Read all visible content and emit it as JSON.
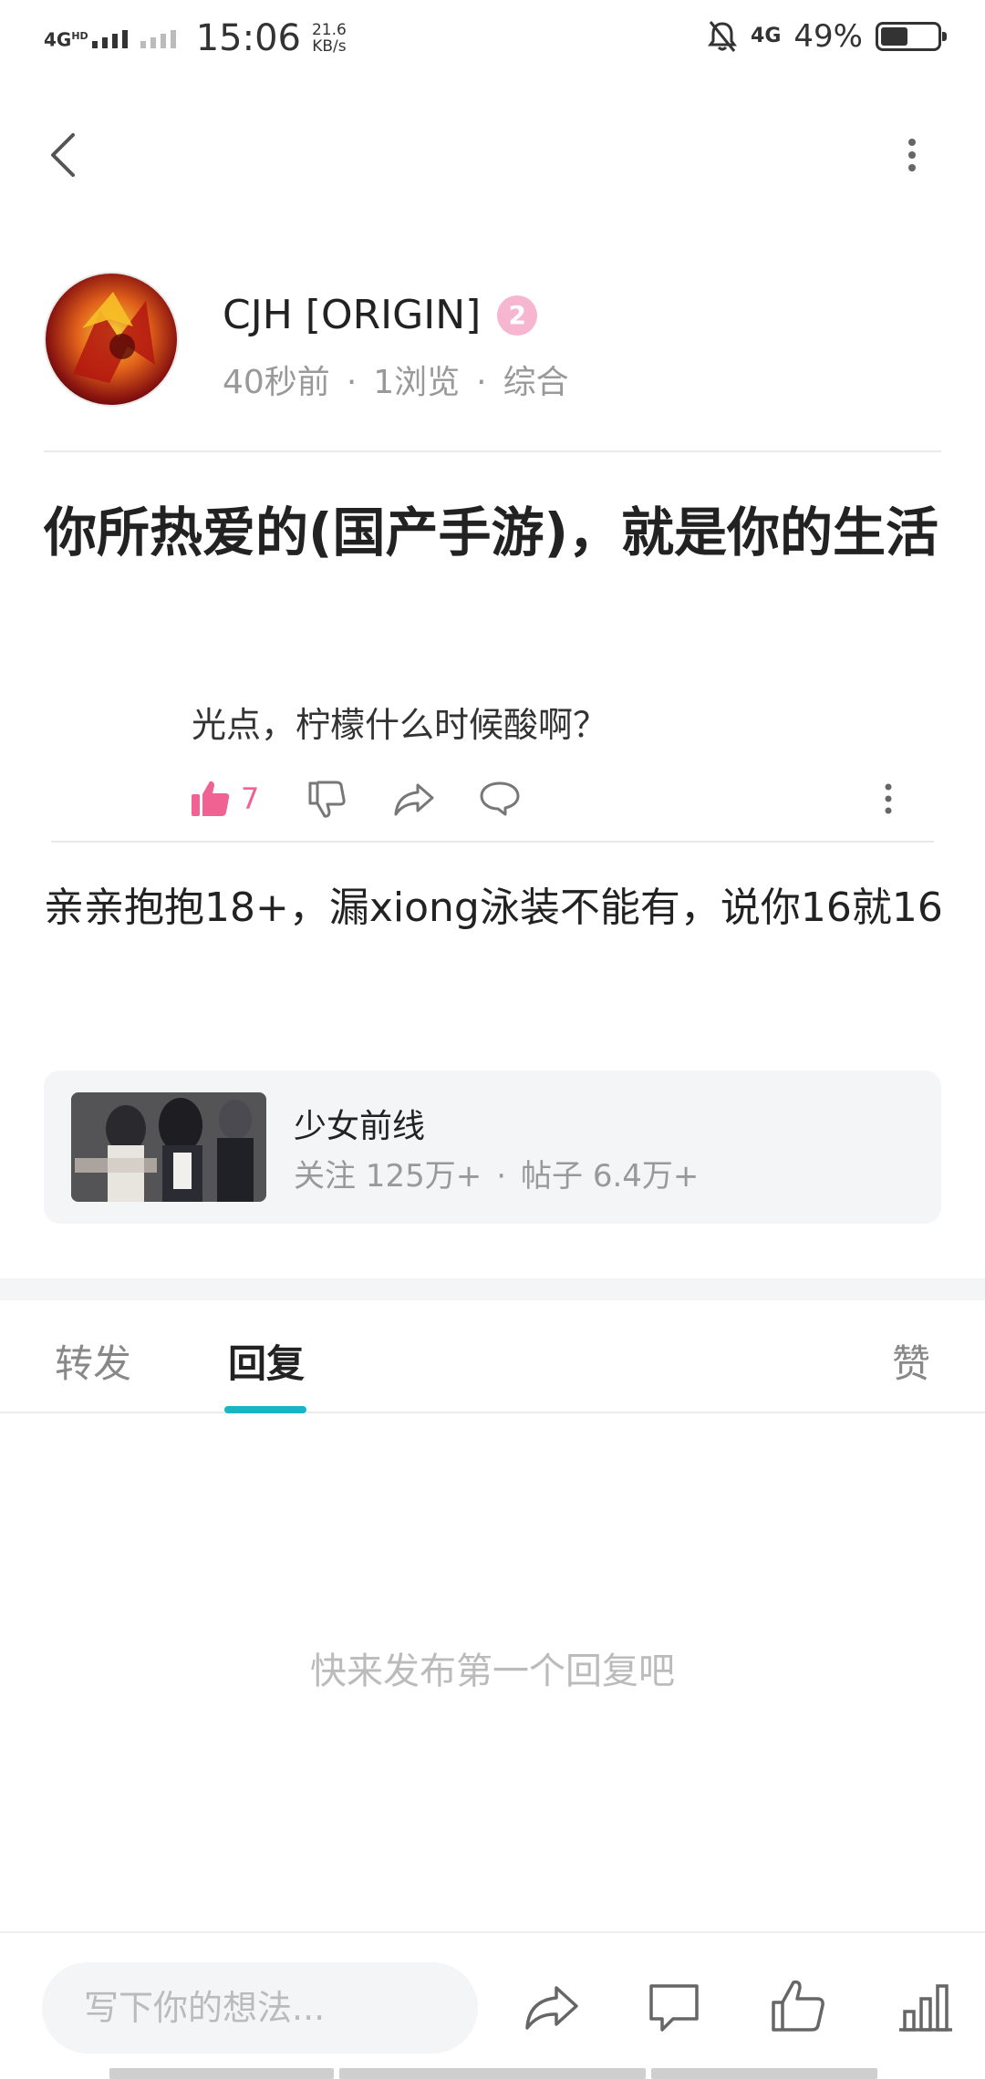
{
  "status_bar": {
    "network_left": "4G",
    "network_left_sup": "HD",
    "time": "15:06",
    "speed_value": "21.6",
    "speed_unit": "KB/s",
    "network_right": "4G",
    "battery_percent": "49%",
    "battery_level": 0.49
  },
  "nav": {
    "back_icon": "chevron-left-icon",
    "more_icon": "more-vertical-icon"
  },
  "author": {
    "name": "CJH [ORIGIN]",
    "level": "2",
    "time_ago": "40秒前",
    "views": "1浏览",
    "category": "综合",
    "separator": "·"
  },
  "post": {
    "title": "你所热爱的(国产手游)，就是你的生活",
    "quote_text": "光点，柠檬什么时候酸啊？",
    "quote_like_count": "7",
    "body": "亲亲抱抱18+，漏xiong泳装不能有，说你16就16"
  },
  "forum": {
    "name": "少女前线",
    "followers": "关注 125万+",
    "posts": "帖子 6.4万+",
    "separator": "·"
  },
  "tabs": {
    "forward": "转发",
    "reply": "回复",
    "like": "赞",
    "active": "回复"
  },
  "replies": {
    "empty_hint": "快来发布第一个回复吧"
  },
  "bottom_bar": {
    "input_placeholder": "写下你的想法...",
    "icons": [
      "share-icon",
      "comment-icon",
      "thumbs-up-icon",
      "stats-icon"
    ]
  },
  "colors": {
    "accent": "#19b5c3",
    "like_active": "#f06292",
    "level_badge": "#f6b6cf",
    "muted_text": "#999999",
    "card_bg": "#f4f5f7"
  }
}
